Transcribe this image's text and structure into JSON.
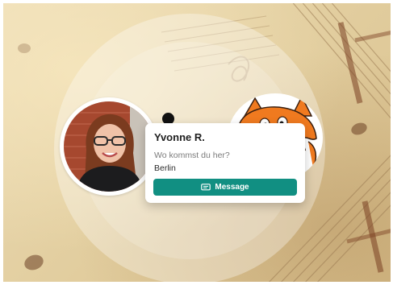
{
  "profile_card": {
    "name": "Yvonne R.",
    "question": "Wo kommst du her?",
    "answer": "Berlin",
    "message_button": {
      "label": "Message",
      "icon": "chat-bubble-icon"
    }
  },
  "colors": {
    "accent": "#118f82",
    "card_background": "#ffffff",
    "background": "#e3cfa1",
    "mascot_fur": "#f07a1f"
  }
}
